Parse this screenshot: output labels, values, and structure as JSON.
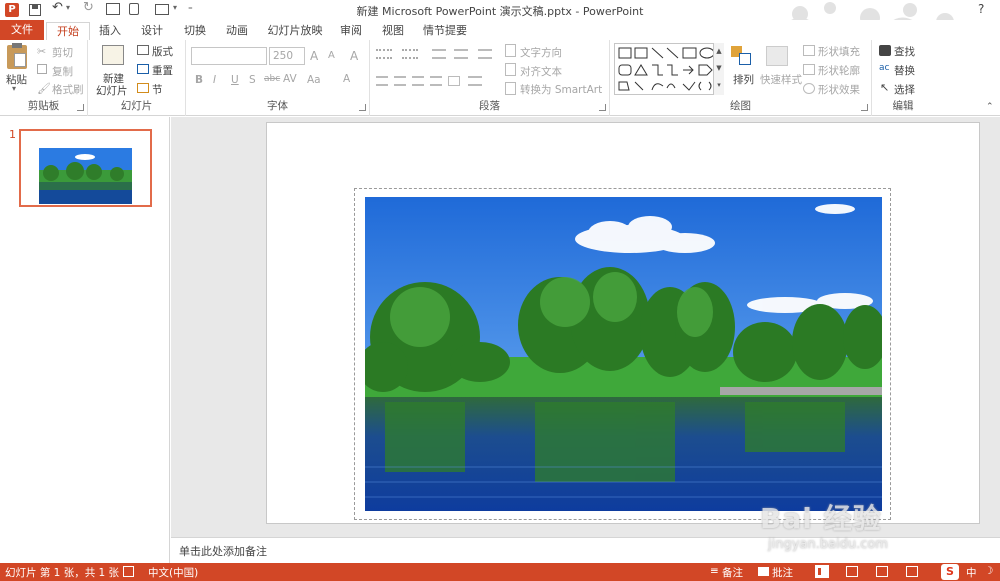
{
  "window": {
    "title": "新建 Microsoft PowerPoint 演示文稿.pptx - PowerPoint",
    "help": "?"
  },
  "qat": {
    "undo_arrow": "▾",
    "more": "▾"
  },
  "tabs": [
    "文件",
    "开始",
    "插入",
    "设计",
    "切换",
    "动画",
    "幻灯片放映",
    "审阅",
    "视图",
    "情节提要"
  ],
  "ribbon": {
    "clipboard": {
      "label": "剪贴板",
      "paste": "粘贴",
      "cut": "剪切",
      "copy": "复制",
      "format_painter": "格式刷"
    },
    "slides": {
      "label": "幻灯片",
      "new_slide_1": "新建",
      "new_slide_2": "幻灯片",
      "layout": "版式",
      "reset": "重置",
      "section": "节"
    },
    "font": {
      "label": "字体",
      "font_name": "",
      "font_size": "250",
      "bold": "B",
      "italic": "I",
      "underline": "U",
      "shadow": "S",
      "strike": "abc",
      "spacing": "AV",
      "case": "Aa",
      "grow": "A",
      "shrink": "A",
      "clear": "A"
    },
    "paragraph": {
      "label": "段落",
      "text_direction": "文字方向",
      "align_text": "对齐文本",
      "smartart": "转换为 SmartArt"
    },
    "drawing": {
      "label": "绘图",
      "arrange": "排列",
      "quick_styles": "快速样式",
      "shape_fill": "形状填充",
      "shape_outline": "形状轮廓",
      "shape_effects": "形状效果"
    },
    "editing": {
      "label": "编辑",
      "find": "查找",
      "replace": "替换",
      "select": "选择"
    }
  },
  "thumbnail": {
    "number": "1"
  },
  "notes": {
    "placeholder": "单击此处添加备注"
  },
  "status": {
    "slide_info": "幻灯片 第 1 张，共 1 张",
    "language": "中文(中国)",
    "notes": "备注",
    "comments": "批注",
    "ime": "中"
  },
  "watermark": {
    "line1": "Bai 经验",
    "line2": "jingyan.baidu.com"
  },
  "colors": {
    "accent": "#d24726",
    "sky": "#1e6fd6",
    "tree": "#3f9a35",
    "water": "#1450a8"
  }
}
